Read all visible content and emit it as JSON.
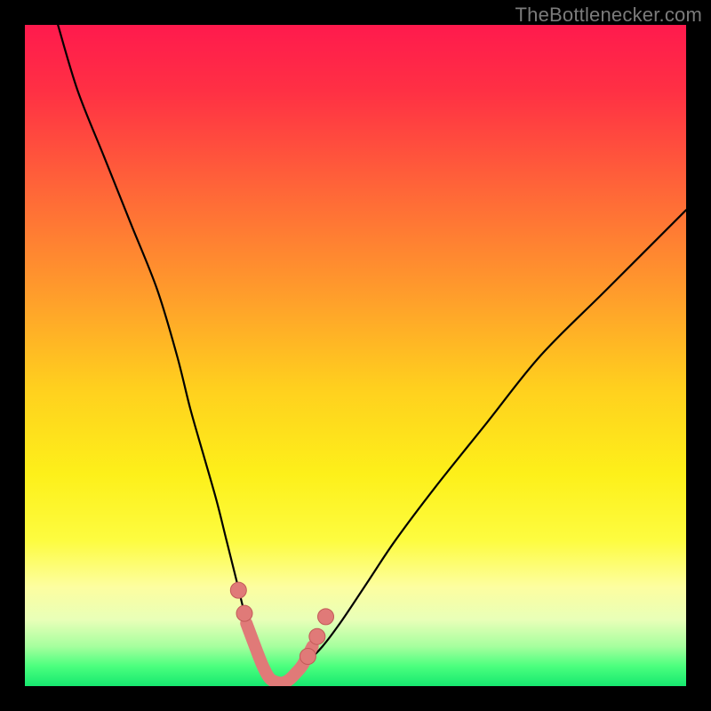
{
  "watermark": {
    "text": "TheBottlenecker.com"
  },
  "colors": {
    "gradient_stops": [
      {
        "offset": 0.0,
        "color": "#ff1a4d"
      },
      {
        "offset": 0.1,
        "color": "#ff3044"
      },
      {
        "offset": 0.25,
        "color": "#ff6638"
      },
      {
        "offset": 0.4,
        "color": "#ff9a2c"
      },
      {
        "offset": 0.55,
        "color": "#ffd01e"
      },
      {
        "offset": 0.68,
        "color": "#fdf01a"
      },
      {
        "offset": 0.78,
        "color": "#fdfc40"
      },
      {
        "offset": 0.85,
        "color": "#fdfea0"
      },
      {
        "offset": 0.9,
        "color": "#e8ffb8"
      },
      {
        "offset": 0.94,
        "color": "#a6ff9e"
      },
      {
        "offset": 0.97,
        "color": "#4bff7e"
      },
      {
        "offset": 1.0,
        "color": "#16e86f"
      }
    ],
    "curve": "#000000",
    "marker_fill": "#e07a78",
    "marker_stroke": "#c25a58",
    "frame": "#000000"
  },
  "chart_data": {
    "type": "line",
    "title": "",
    "xlabel": "",
    "ylabel": "",
    "xlim": [
      0,
      100
    ],
    "ylim": [
      0,
      100
    ],
    "grid": false,
    "legend": false,
    "series": [
      {
        "name": "left-branch",
        "x": [
          5,
          8,
          12,
          16,
          20,
          23,
          25,
          27,
          29,
          30.5,
          32,
          33.5,
          35,
          36,
          37,
          38
        ],
        "y": [
          100,
          90,
          80,
          70,
          60,
          50,
          42,
          35,
          28,
          22,
          16,
          10,
          6,
          3,
          1.2,
          0.5
        ]
      },
      {
        "name": "right-branch",
        "x": [
          38,
          40,
          42,
          45,
          48,
          52,
          56,
          62,
          70,
          78,
          88,
          100
        ],
        "y": [
          0.5,
          1.5,
          3,
          6,
          10,
          16,
          22,
          30,
          40,
          50,
          60,
          72
        ]
      }
    ],
    "valley_segment": {
      "name": "valley-highlight",
      "x": [
        33.5,
        35,
        36,
        37,
        38,
        39,
        40,
        41,
        42,
        43.5
      ],
      "y": [
        9.5,
        5.5,
        3,
        1.2,
        0.6,
        0.5,
        1,
        2,
        3.2,
        6
      ]
    },
    "markers": [
      {
        "name": "marker-left-upper",
        "x": 32.3,
        "y": 14.5
      },
      {
        "name": "marker-left-lower",
        "x": 33.2,
        "y": 11.0
      },
      {
        "name": "marker-right-lower",
        "x": 42.8,
        "y": 4.5
      },
      {
        "name": "marker-right-mid",
        "x": 44.2,
        "y": 7.5
      },
      {
        "name": "marker-right-upper",
        "x": 45.5,
        "y": 10.5
      }
    ]
  }
}
